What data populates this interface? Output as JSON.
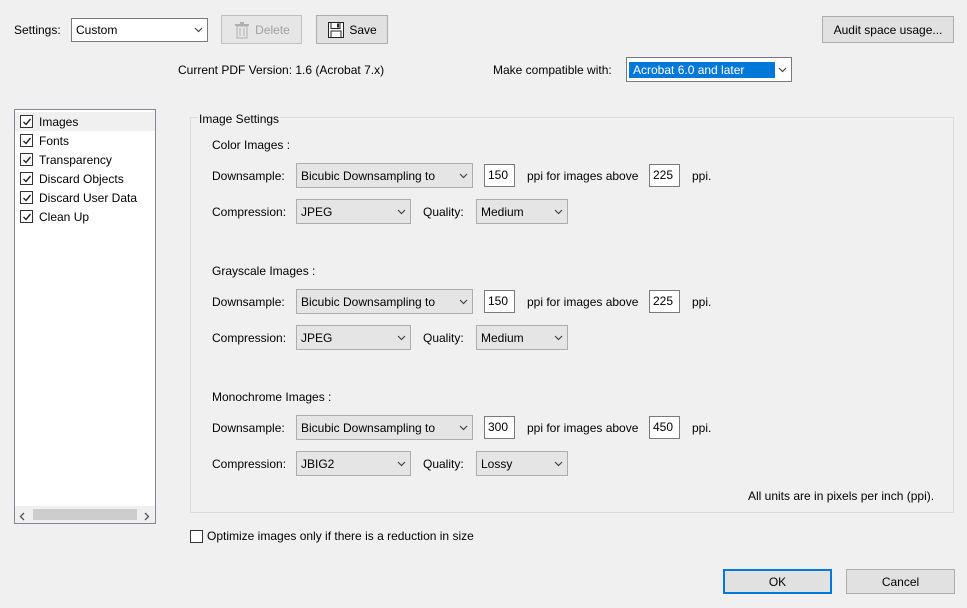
{
  "toolbar": {
    "settings_label": "Settings:",
    "settings_value": "Custom",
    "delete_label": "Delete",
    "save_label": "Save",
    "audit_label": "Audit space usage..."
  },
  "version": {
    "current_text": "Current PDF Version: 1.6 (Acrobat 7.x)",
    "compat_label": "Make compatible with:",
    "compat_value": "Acrobat 6.0 and later"
  },
  "panels": [
    {
      "label": "Images",
      "checked": true
    },
    {
      "label": "Fonts",
      "checked": true
    },
    {
      "label": "Transparency",
      "checked": true
    },
    {
      "label": "Discard Objects",
      "checked": true
    },
    {
      "label": "Discard User Data",
      "checked": true
    },
    {
      "label": "Clean Up",
      "checked": true
    }
  ],
  "image_settings": {
    "title": "Image Settings",
    "labels": {
      "downsample": "Downsample:",
      "compression": "Compression:",
      "quality": "Quality:",
      "ppi_above": "ppi for images above",
      "ppi": "ppi."
    },
    "color": {
      "heading": "Color Images :",
      "downsample": "Bicubic Downsampling to",
      "ppi": "150",
      "above": "225",
      "compression": "JPEG",
      "quality": "Medium"
    },
    "grayscale": {
      "heading": "Grayscale Images :",
      "downsample": "Bicubic Downsampling to",
      "ppi": "150",
      "above": "225",
      "compression": "JPEG",
      "quality": "Medium"
    },
    "mono": {
      "heading": "Monochrome Images :",
      "downsample": "Bicubic Downsampling to",
      "ppi": "300",
      "above": "450",
      "compression": "JBIG2",
      "quality": "Lossy"
    },
    "units_note": "All units are in pixels per inch (ppi)."
  },
  "optimize": {
    "label": "Optimize images only if there is a reduction in size",
    "checked": false
  },
  "footer": {
    "ok_label": "OK",
    "cancel_label": "Cancel"
  }
}
